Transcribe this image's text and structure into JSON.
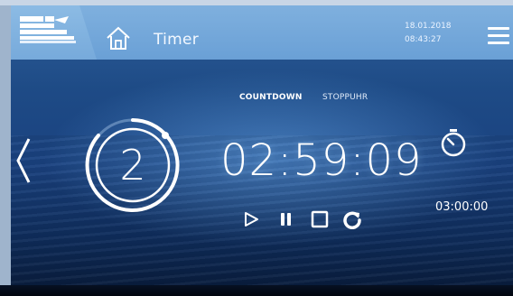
{
  "header": {
    "title": "Timer",
    "date": "18.01.2018",
    "time": "08:43:27"
  },
  "tabs": [
    {
      "label": "COUNTDOWN",
      "active": true
    },
    {
      "label": "STOPPUHR",
      "active": false
    }
  ],
  "timer": {
    "counter": "2",
    "display": "02:59:09",
    "preset": "03:00:00"
  },
  "icons": {
    "logo": "brand-logo",
    "home": "home-icon",
    "menu": "hamburger-menu-icon",
    "back": "chevron-left-icon",
    "timer": "stopwatch-icon",
    "play": "play-icon",
    "pause": "pause-icon",
    "stop": "stop-icon",
    "reset": "reset-icon"
  },
  "colors": {
    "header": "#6aa0d6",
    "background": "#1a4280",
    "text": "#ffffff"
  }
}
